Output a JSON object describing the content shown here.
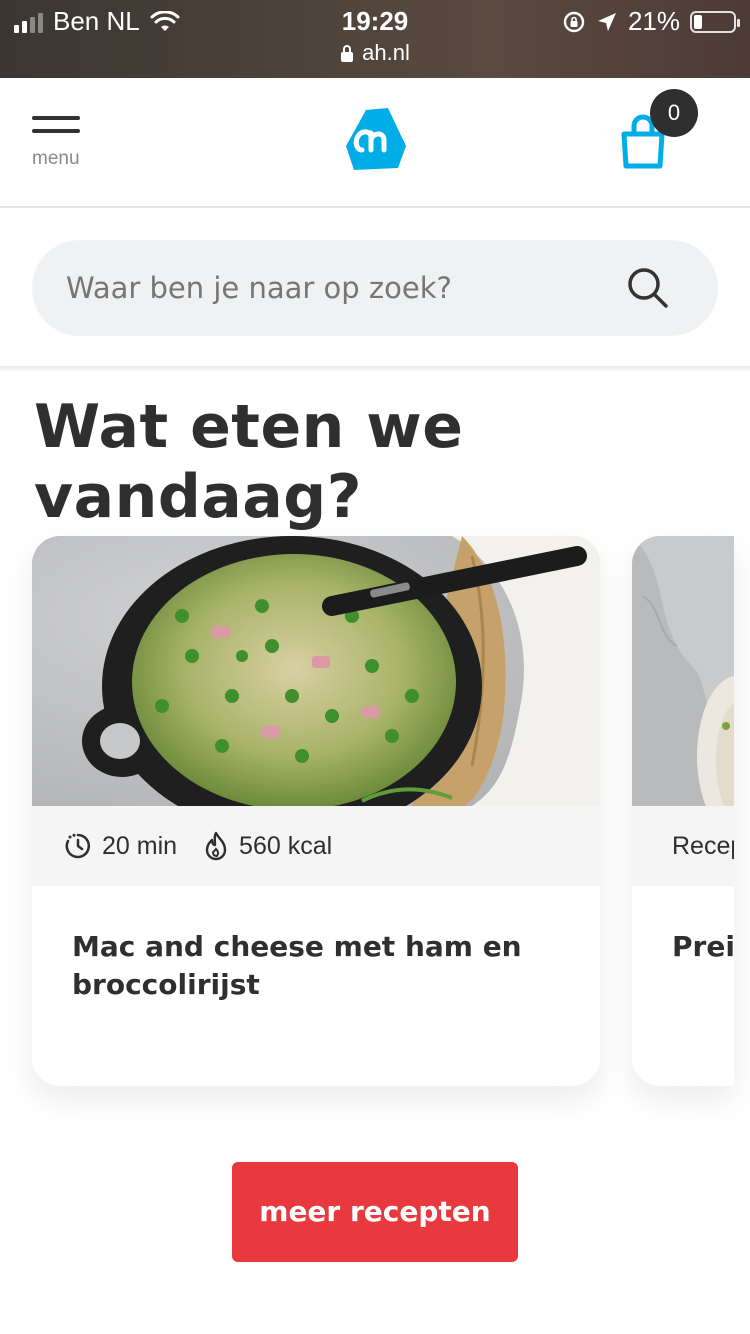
{
  "status_bar": {
    "carrier": "Ben NL",
    "time": "19:29",
    "url": "ah.nl",
    "battery": "21%"
  },
  "header": {
    "menu_label": "menu",
    "cart_count": "0"
  },
  "search": {
    "placeholder": "Waar ben je naar op zoek?"
  },
  "section": {
    "title": "Wat eten we vandaag?"
  },
  "recipes": [
    {
      "time": "20 min",
      "kcal": "560 kcal",
      "title": "Mac and cheese met ham en broccolirijst"
    },
    {
      "meta": "Recep",
      "title": "Preil"
    }
  ],
  "cta": {
    "label": "meer recepten"
  },
  "colors": {
    "brand_blue": "#00ade6",
    "cta_red": "#e8393f"
  }
}
